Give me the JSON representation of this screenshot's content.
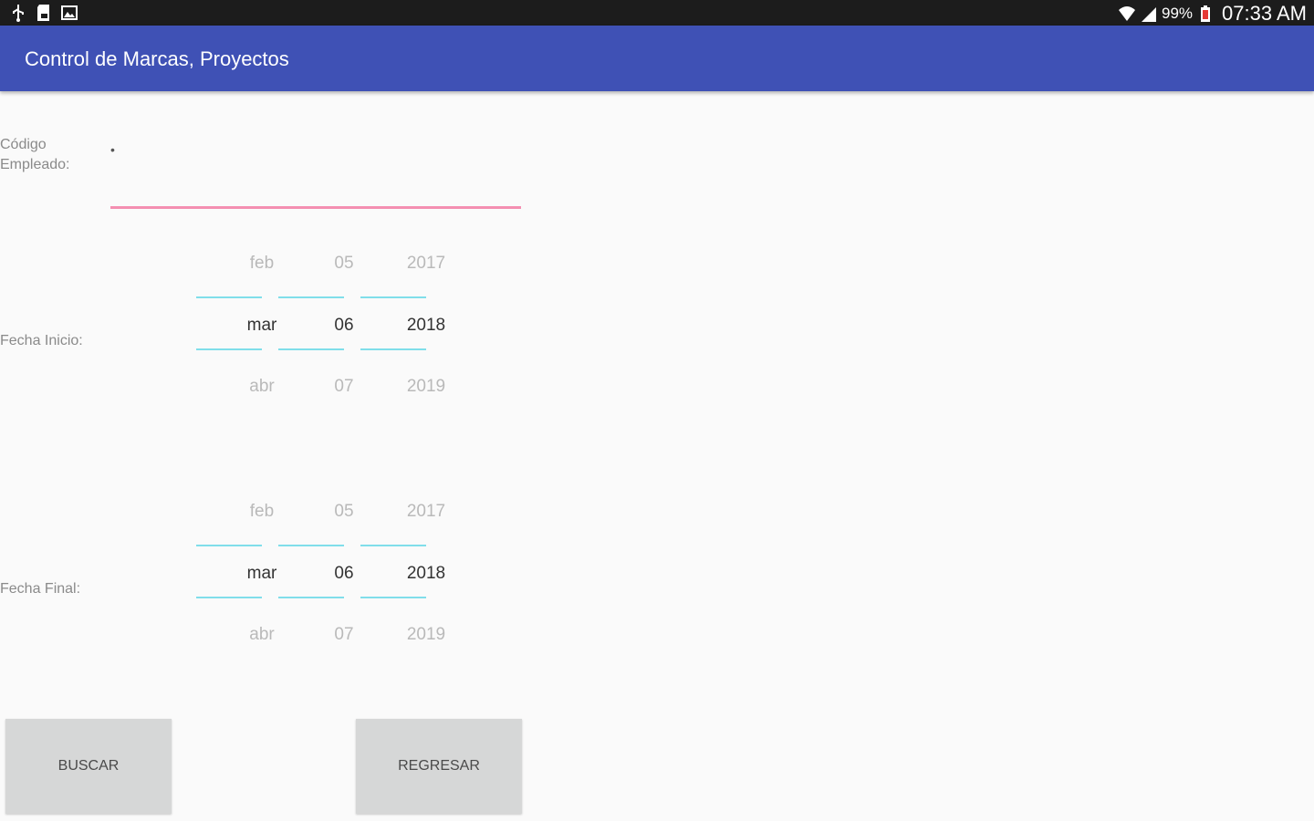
{
  "status_bar": {
    "left_icons": [
      "usb-icon",
      "sd-card-icon",
      "image-icon"
    ],
    "right_icons": [
      "wifi-icon",
      "signal-icon"
    ],
    "battery": "99%",
    "time": "07:33 AM"
  },
  "app_bar": {
    "title": "Control de Marcas, Proyectos"
  },
  "form": {
    "code_label_line1": "Código",
    "code_label_line2": "Empleado:",
    "code_marker": "•",
    "code_value": "",
    "start_label": "Fecha Inicio:",
    "end_label": "Fecha Final:",
    "start_picker": {
      "month": {
        "prev": "feb",
        "selected": "mar",
        "next": "abr"
      },
      "day": {
        "prev": "05",
        "selected": "06",
        "next": "07"
      },
      "year": {
        "prev": "2017",
        "selected": "2018",
        "next": "2019"
      }
    },
    "end_picker": {
      "month": {
        "prev": "feb",
        "selected": "mar",
        "next": "abr"
      },
      "day": {
        "prev": "05",
        "selected": "06",
        "next": "07"
      },
      "year": {
        "prev": "2017",
        "selected": "2018",
        "next": "2019"
      }
    }
  },
  "buttons": {
    "search": "BUSCAR",
    "back": "REGRESAR"
  },
  "colors": {
    "app_bar": "#3f51b5",
    "input_underline": "#f48fb1",
    "picker_line": "#80deea"
  }
}
